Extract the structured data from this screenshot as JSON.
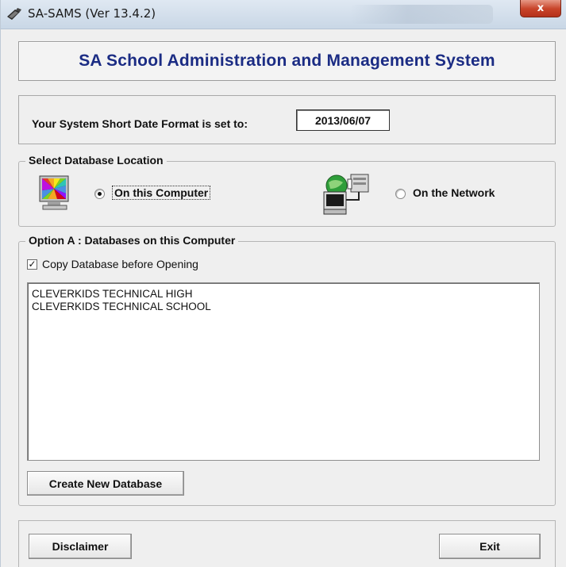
{
  "window": {
    "title": "SA-SAMS (Ver 13.4.2)",
    "close_label": "x",
    "icon": "pencil-book-icon"
  },
  "header": {
    "system_title": "SA School Administration and Management System"
  },
  "date_format": {
    "label": "Your System Short Date Format is set to:",
    "value": "2013/06/07"
  },
  "db_location": {
    "legend": "Select Database Location",
    "options": [
      {
        "label": "On this Computer",
        "selected": true,
        "icon": "computer-monitor-icon"
      },
      {
        "label": "On the Network",
        "selected": false,
        "icon": "network-computer-icon"
      }
    ]
  },
  "option_a": {
    "legend": "Option A : Databases on this Computer",
    "copy_checkbox": {
      "label": "Copy Database before Opening",
      "checked": true
    },
    "databases": [
      "CLEVERKIDS TECHNICAL HIGH",
      "CLEVERKIDS TECHNICAL SCHOOL"
    ],
    "create_button": "Create New Database"
  },
  "footer": {
    "disclaimer_button": "Disclaimer",
    "exit_button": "Exit"
  },
  "colors": {
    "title_blue": "#1b2c84",
    "window_bg": "#efefef",
    "close_red": "#c8442a"
  }
}
